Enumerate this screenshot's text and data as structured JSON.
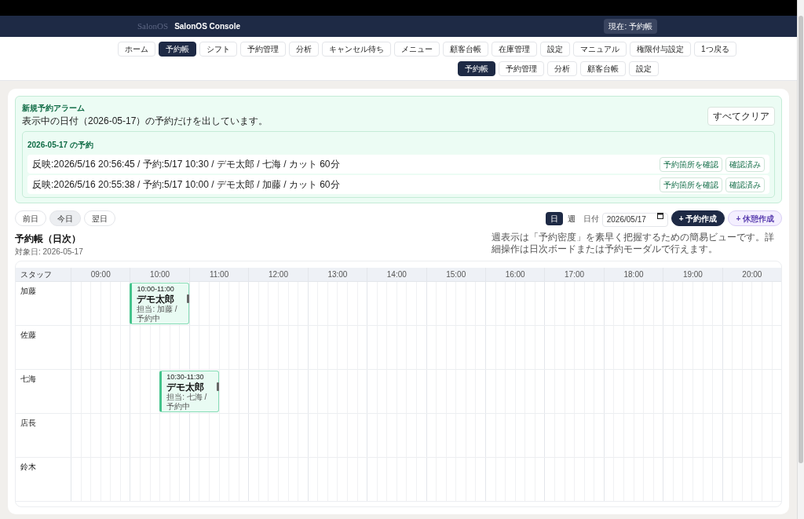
{
  "header": {
    "logo": "SalonOS",
    "title": "SalonOS Console",
    "current": "現在: 予約帳"
  },
  "nav": [
    {
      "label": "ホーム",
      "selected": false
    },
    {
      "label": "予約帳",
      "selected": true
    },
    {
      "label": "シフト",
      "selected": false
    },
    {
      "label": "予約管理",
      "selected": false
    },
    {
      "label": "分析",
      "selected": false
    },
    {
      "label": "キャンセル待ち",
      "selected": false
    },
    {
      "label": "メニュー",
      "selected": false
    },
    {
      "label": "顧客台帳",
      "selected": false
    },
    {
      "label": "在庫管理",
      "selected": false
    },
    {
      "label": "設定",
      "selected": false
    },
    {
      "label": "マニュアル",
      "selected": false
    },
    {
      "label": "権限付与設定",
      "selected": false
    },
    {
      "label": "1つ戻る",
      "selected": false
    }
  ],
  "subnav": [
    {
      "label": "予約帳",
      "selected": true
    },
    {
      "label": "予約管理",
      "selected": false
    },
    {
      "label": "分析",
      "selected": false
    },
    {
      "label": "顧客台帳",
      "selected": false
    },
    {
      "label": "設定",
      "selected": false
    }
  ],
  "alarm": {
    "title": "新規予約アラーム",
    "description": "表示中の日付（2026-05-17）の予約だけを出しています。",
    "clear_button": "すべてクリア",
    "group_title": "2026-05-17 の予約",
    "items": [
      {
        "text": "反映:2026/5/16 20:56:45 / 予約:5/17 10:30 / デモ太郎 / 七海 / カット 60分",
        "locate_button": "予約箇所を確認",
        "confirm_button": "確認済み"
      },
      {
        "text": "反映:2026/5/16 20:55:38 / 予約:5/17 10:00 / デモ太郎 / 加藤 / カット 60分",
        "locate_button": "予約箇所を確認",
        "confirm_button": "確認済み"
      }
    ]
  },
  "day_nav": [
    {
      "label": "前日",
      "selected": false
    },
    {
      "label": "今日",
      "selected": true
    },
    {
      "label": "翌日",
      "selected": false
    }
  ],
  "view_toggle": [
    {
      "label": "日",
      "selected": true
    },
    {
      "label": "週",
      "selected": false
    }
  ],
  "date_field": {
    "label": "日付",
    "value": "2026/05/17"
  },
  "create_buttons": [
    {
      "label": "+ 予約作成",
      "kind": "primary"
    },
    {
      "label": "+ 休憩作成",
      "kind": "secondary"
    }
  ],
  "schedule": {
    "title": "予約帳（日次）",
    "subtitle": "対象日: 2026-05-17",
    "note": "週表示は「予約密度」を素早く把握するための簡易ビューです。詳細操作は日次ボードまたは予約モーダルで行えます。",
    "staff_header": "スタッフ",
    "hours": [
      "09:00",
      "10:00",
      "11:00",
      "12:00",
      "13:00",
      "14:00",
      "15:00",
      "16:00",
      "17:00",
      "18:00",
      "19:00",
      "20:00"
    ],
    "staff": [
      {
        "name": "加藤",
        "appointments": [
          {
            "time": "10:00-11:00",
            "customer": "デモ太郎",
            "detail": "担当: 加藤 / 予約中"
          }
        ]
      },
      {
        "name": "佐藤"
      },
      {
        "name": "七海",
        "appointments": [
          {
            "time": "10:30-11:30",
            "customer": "デモ太郎",
            "detail": "担当: 七海 / 予約中"
          }
        ]
      },
      {
        "name": "店長"
      },
      {
        "name": "鈴木"
      }
    ]
  }
}
